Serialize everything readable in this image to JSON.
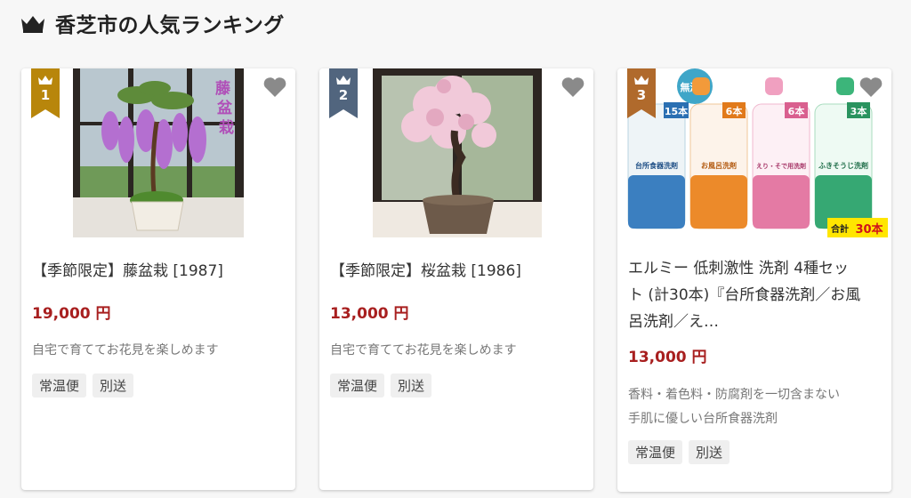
{
  "page": {
    "title": "香芝市の人気ランキング"
  },
  "products": [
    {
      "rank": "1",
      "rank_color": "#b8860b",
      "title": "【季節限定】藤盆栽 [1987]",
      "price": "19,000 円",
      "description": "自宅で育ててお花見を楽しめます",
      "tags": [
        "常温便",
        "別送"
      ],
      "image_text": "藤盆栽"
    },
    {
      "rank": "2",
      "rank_color": "#51657e",
      "title": "【季節限定】桜盆栽 [1986]",
      "price": "13,000 円",
      "description": "自宅で育ててお花見を楽しめます",
      "tags": [
        "常温便",
        "別送"
      ]
    },
    {
      "rank": "3",
      "rank_color": "#b06a2c",
      "title": "エルミー 低刺激性 洗剤 4種セット (計30本)『台所食器洗剤／お風呂洗剤／え…",
      "title_lines": [
        "エルミー 低刺激性 洗剤 4種セッ",
        "ト (計30本)『台所食器洗剤／お風",
        "呂洗剤／え…"
      ],
      "price": "13,000 円",
      "description_lines": [
        "香料・着色料・防腐剤を一切含まない",
        "手肌に優しい台所食器洗剤"
      ],
      "tags": [
        "常温便",
        "別送"
      ],
      "image_texts": {
        "badge": "無添加",
        "counts": [
          "15本",
          "6本",
          "6本",
          "3本"
        ],
        "total_prefix": "合計",
        "total_number": "30本",
        "bottle_labels": [
          "台所食器洗剤",
          "お風呂洗剤",
          "えり・そで用洗剤",
          "ふきそうじ洗剤"
        ]
      }
    }
  ],
  "colors": {
    "price": "#a81f1f",
    "fav_icon": "#8a8a8a"
  }
}
